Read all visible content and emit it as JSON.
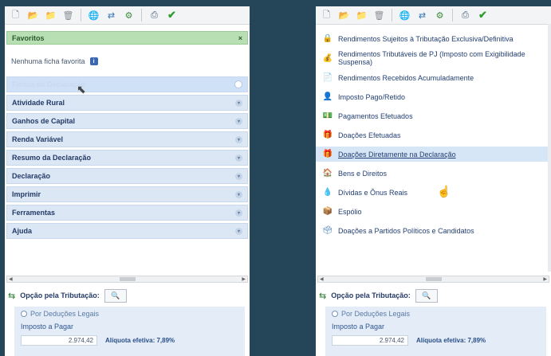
{
  "toolbar_icons": [
    "new-file-icon",
    "open-folder-icon",
    "folder-icon",
    "trash-icon",
    "globe-icon",
    "sync-icon",
    "certificate-icon",
    "printer-icon",
    "check-icon"
  ],
  "left": {
    "favorites": {
      "label": "Favoritos",
      "close": "×"
    },
    "favorites_empty": "Nenhuma ficha favorita",
    "info_glyph": "i",
    "categories": [
      {
        "label": "Fichas da Declaração",
        "state": "hover"
      },
      {
        "label": "Atividade Rural"
      },
      {
        "label": "Ganhos de Capital"
      },
      {
        "label": "Renda Variável"
      },
      {
        "label": "Resumo da Declaração"
      },
      {
        "label": "Declaração"
      },
      {
        "label": "Imprimir"
      },
      {
        "label": "Ferramentas"
      },
      {
        "label": "Ajuda"
      }
    ]
  },
  "right": {
    "items": [
      {
        "label": "Rendimentos Sujeitos à Tributação Exclusiva/Definitiva",
        "icon": "lock-icon",
        "glyph": "🔒"
      },
      {
        "label": "Rendimentos Tributáveis de PJ (Imposto com Exigibilidade Suspensa)",
        "icon": "coins-icon",
        "glyph": "💰"
      },
      {
        "label": "Rendimentos Recebidos Acumuladamente",
        "icon": "document-icon",
        "glyph": "📄"
      },
      {
        "label": "Imposto Pago/Retido",
        "icon": "person-icon",
        "glyph": "👤"
      },
      {
        "label": "Pagamentos Efetuados",
        "icon": "cash-icon",
        "glyph": "💵"
      },
      {
        "label": "Doações Efetuadas",
        "icon": "gift-icon",
        "glyph": "🎁"
      },
      {
        "label": "Doações Diretamente na Declaração",
        "icon": "gift-hand-icon",
        "glyph": "🎁",
        "selected": true
      },
      {
        "label": "Bens e Direitos",
        "icon": "house-icon",
        "glyph": "🏠"
      },
      {
        "label": "Dívidas e Ônus Reais",
        "icon": "drop-icon",
        "glyph": "💧"
      },
      {
        "label": "Espólio",
        "icon": "box-icon",
        "glyph": "📦"
      },
      {
        "label": "Doações a Partidos Políticos e Candidatos",
        "icon": "vote-icon",
        "glyph": "🗳"
      }
    ]
  },
  "tax": {
    "label": "Opção pela Tributação:",
    "search_glyph": "🔍",
    "option": "Por Deduções Legais",
    "to_pay": "Imposto a Pagar",
    "amount": "2.974,42",
    "aliquota": "Alíquota efetiva: 7,89%"
  },
  "colors": {
    "background": "#254559",
    "favorites_bg": "#b7dfb3",
    "category_bg": "#dbe7f5",
    "selected_bg": "#d7e6f6",
    "result_bg": "#e3ecf7"
  }
}
